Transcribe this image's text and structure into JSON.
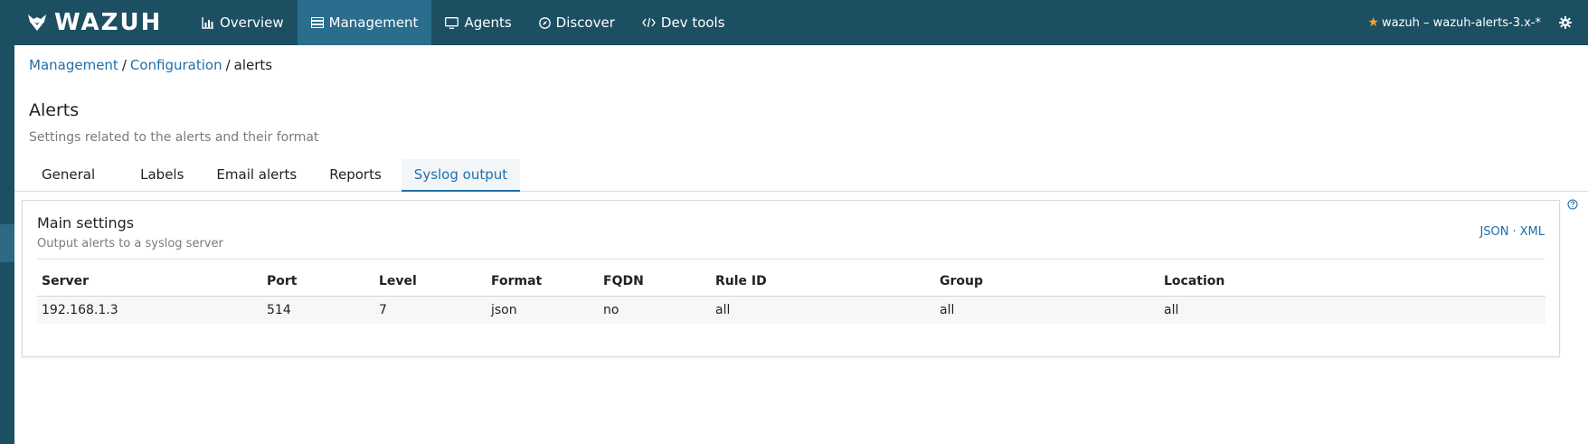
{
  "nav": {
    "logo": "WAZUH",
    "items": [
      {
        "label": "Overview",
        "icon": "bar-chart-icon",
        "active": false
      },
      {
        "label": "Management",
        "icon": "list-icon",
        "active": true
      },
      {
        "label": "Agents",
        "icon": "monitor-icon",
        "active": false
      },
      {
        "label": "Discover",
        "icon": "compass-icon",
        "active": false
      },
      {
        "label": "Dev tools",
        "icon": "code-icon",
        "active": false
      }
    ],
    "index_pattern": "wazuh – wazuh-alerts-3.x-*",
    "star_icon": "star-icon",
    "settings_icon": "gear-icon"
  },
  "breadcrumb": {
    "items": [
      "Management",
      "Configuration"
    ],
    "current": "alerts",
    "separator": "/"
  },
  "page": {
    "title": "Alerts",
    "subtitle": "Settings related to the alerts and their format"
  },
  "tabs": [
    {
      "label": "General",
      "active": false
    },
    {
      "label": "Labels",
      "active": false
    },
    {
      "label": "Email alerts",
      "active": false
    },
    {
      "label": "Reports",
      "active": false
    },
    {
      "label": "Syslog output",
      "active": true
    }
  ],
  "panel": {
    "title": "Main settings",
    "subtitle": "Output alerts to a syslog server",
    "links": [
      "JSON",
      "XML"
    ],
    "link_separator": "·",
    "table": {
      "columns": [
        "Server",
        "Port",
        "Level",
        "Format",
        "FQDN",
        "Rule ID",
        "Group",
        "Location"
      ],
      "rows": [
        [
          "192.168.1.3",
          "514",
          "7",
          "json",
          "no",
          "all",
          "all",
          "all"
        ]
      ]
    }
  },
  "colors": {
    "nav_bg": "#1d4f63",
    "nav_active": "#2a6d8c",
    "link": "#1f6fa9",
    "star": "#f5a623"
  }
}
